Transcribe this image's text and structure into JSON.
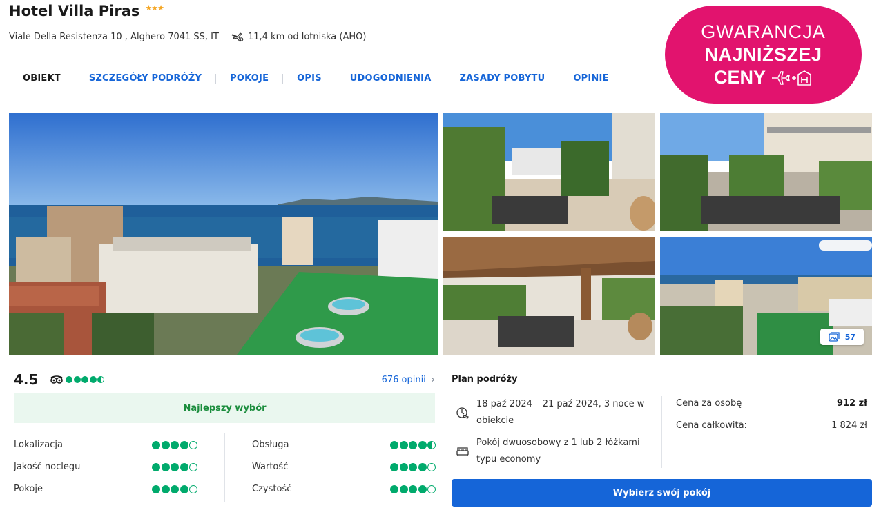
{
  "hotel": {
    "name": "Hotel Villa Piras",
    "stars": 3,
    "stars_glyph": "★★★",
    "address": "Viale Della Resistenza 10 , Alghero 7041 SS, IT",
    "airport_distance": "11,4 km od lotniska (AHO)"
  },
  "tabs": [
    {
      "label": "OBIEKT",
      "active": true
    },
    {
      "label": "SZCZEGÓŁY PODRÓŻY",
      "active": false
    },
    {
      "label": "POKOJE",
      "active": false
    },
    {
      "label": "OPIS",
      "active": false
    },
    {
      "label": "UDOGODNIENIA",
      "active": false
    },
    {
      "label": "ZASADY POBYTU",
      "active": false
    },
    {
      "label": "OPINIE",
      "active": false
    }
  ],
  "badge": {
    "line1": "GWARANCJA",
    "line2": "NAJNIŻSZEJ",
    "line3": "CENY",
    "color": "#e2136e"
  },
  "gallery": {
    "photo_count": "57"
  },
  "reviews": {
    "score": "4.5",
    "rating_dots": 4.5,
    "reviews_link": "676 opinii",
    "best_pick": "Najlepszy wybór",
    "categories": [
      {
        "label": "Lokalizacja",
        "value": 4
      },
      {
        "label": "Jakość noclegu",
        "value": 4
      },
      {
        "label": "Pokoje",
        "value": 4
      },
      {
        "label": "Obsługa",
        "value": 4.5
      },
      {
        "label": "Wartość",
        "value": 4
      },
      {
        "label": "Czystość",
        "value": 4
      }
    ]
  },
  "plan": {
    "title": "Plan podróży",
    "dates_line1": "18 paź 2024 – 21 paź 2024, 3 noce w",
    "dates_line2": "obiekcie",
    "room_line1": "Pokój dwuosobowy z 1 lub 2 łóżkami",
    "room_line2": "typu economy",
    "price_per_person_label": "Cena za osobę",
    "price_per_person": "912 zł",
    "total_price_label": "Cena całkowita:",
    "total_price": "1 824 zł",
    "select_button": "Wybierz swój pokój"
  },
  "colors": {
    "link_blue": "#1565d8",
    "tripadvisor_green": "#00aa6c",
    "best_pick_green": "#1b8d3d",
    "star_orange": "#f5a623"
  }
}
